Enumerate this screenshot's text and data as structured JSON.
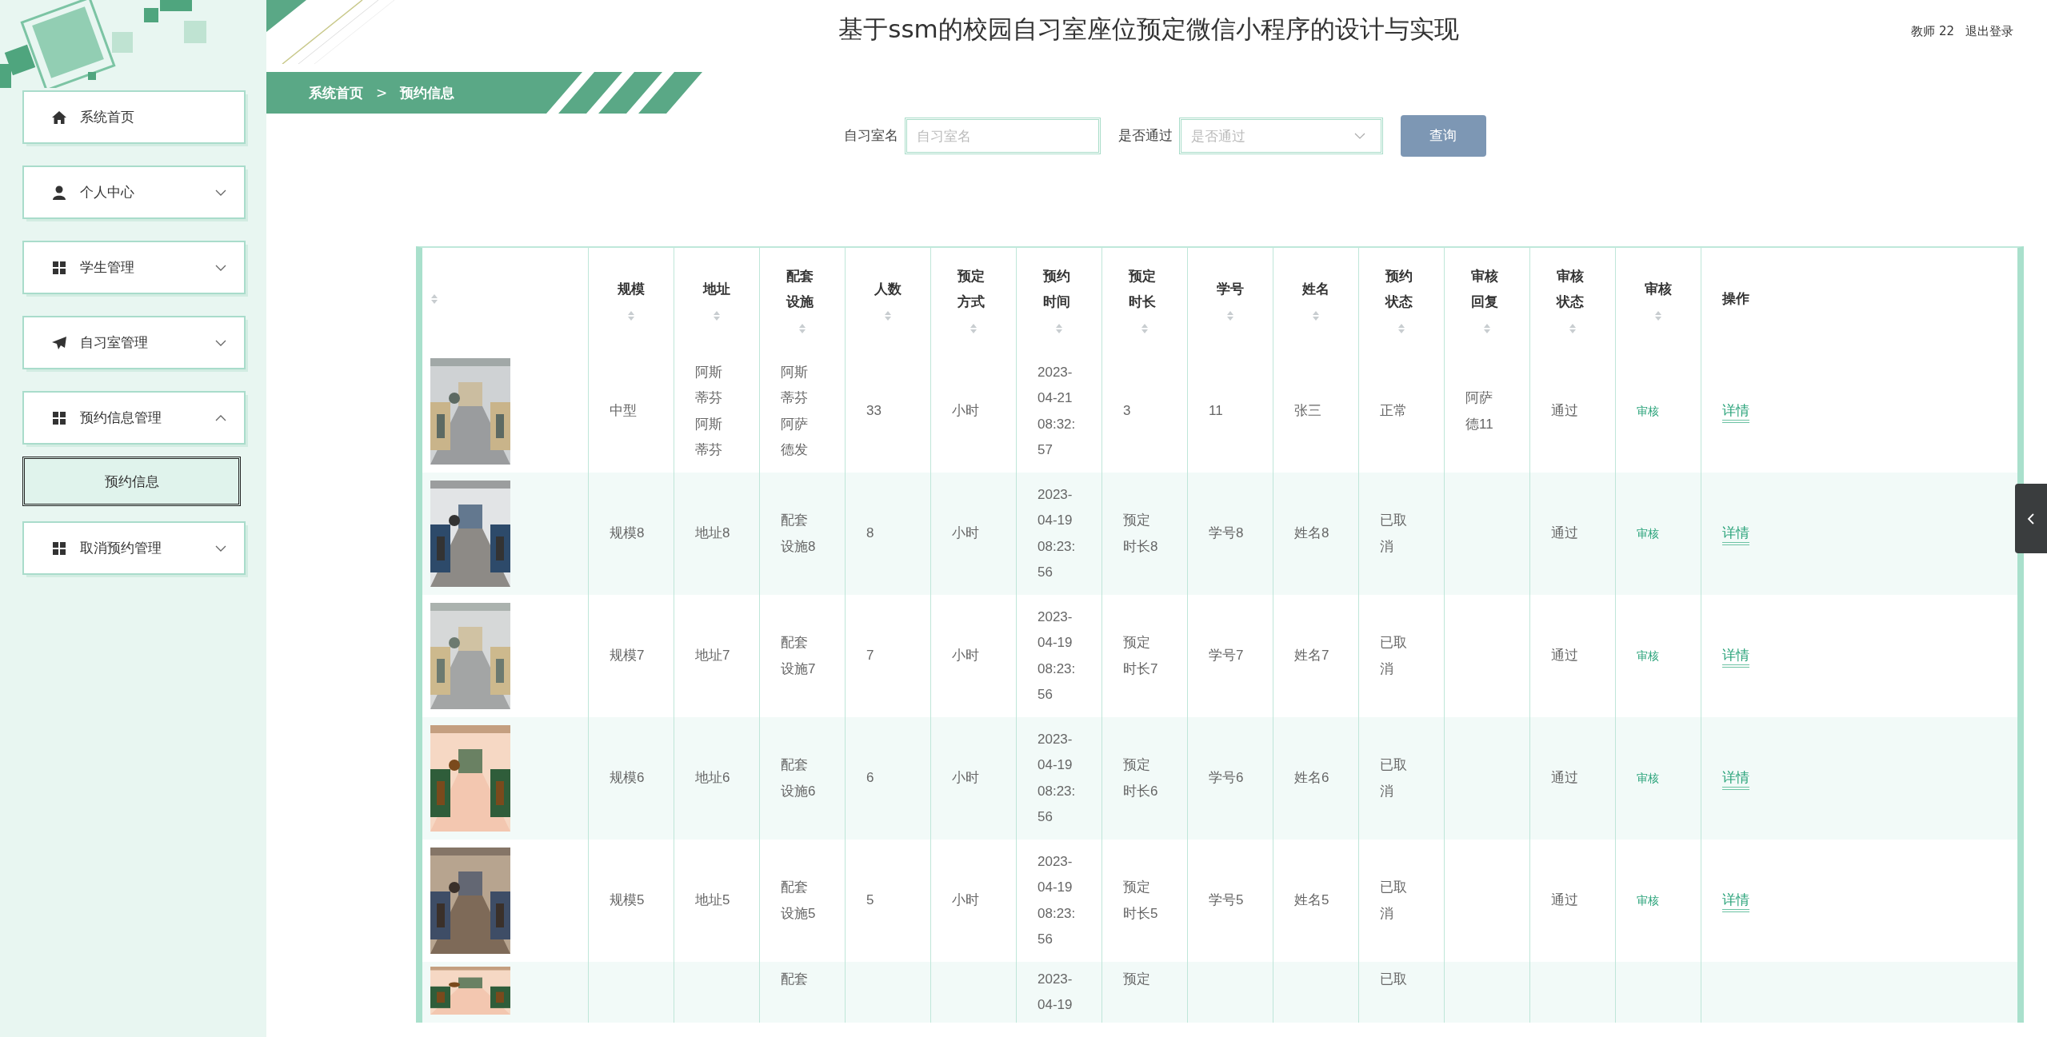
{
  "header": {
    "title": "基于ssm的校园自习室座位预定微信小程序的设计与实现",
    "user": "教师 22",
    "logout": "退出登录"
  },
  "breadcrumb": [
    "系统首页",
    ">",
    "预约信息"
  ],
  "sidebar": {
    "items": [
      {
        "label": "系统首页",
        "kind": "link"
      },
      {
        "label": "个人中心",
        "kind": "menu",
        "expanded": false
      },
      {
        "label": "学生管理",
        "kind": "menu",
        "expanded": false
      },
      {
        "label": "自习室管理",
        "kind": "menu",
        "expanded": false
      },
      {
        "label": "预约信息管理",
        "kind": "menu",
        "expanded": true,
        "children": [
          {
            "label": "预约信息",
            "selected": true
          }
        ]
      },
      {
        "label": "取消预约管理",
        "kind": "menu",
        "expanded": false
      }
    ]
  },
  "search": {
    "fields": [
      {
        "label": "自习室名",
        "placeholder": "自习室名",
        "kind": "text"
      },
      {
        "label": "是否通过",
        "placeholder": "是否通过",
        "kind": "select"
      }
    ],
    "button": "查询"
  },
  "table": {
    "image_column": {
      "sortable": true
    },
    "columns": [
      {
        "label": "规模",
        "sortable": true
      },
      {
        "label": "地址",
        "sortable": true
      },
      {
        "label": "配套设施",
        "sortable": true
      },
      {
        "label": "人数",
        "sortable": true
      },
      {
        "label": "预定方式",
        "sortable": true
      },
      {
        "label": "预约时间",
        "sortable": true
      },
      {
        "label": "预定时长",
        "sortable": true
      },
      {
        "label": "学号",
        "sortable": true
      },
      {
        "label": "姓名",
        "sortable": true
      },
      {
        "label": "预约状态",
        "sortable": true
      },
      {
        "label": "审核回复",
        "sortable": true
      },
      {
        "label": "审核状态",
        "sortable": true
      },
      {
        "label": "审核",
        "sortable": true
      },
      {
        "label": "操作",
        "sortable": false
      }
    ],
    "rows": [
      {
        "cells": [
          "中型",
          "阿斯蒂芬阿斯蒂芬",
          "阿斯蒂芬阿萨德发",
          "33",
          "小时",
          "2023-04-21 08:32:57",
          "3",
          "11",
          "张三",
          "正常",
          "阿萨德11",
          "通过"
        ],
        "review": "审核",
        "detail": "详情"
      },
      {
        "cells": [
          "规模8",
          "地址8",
          "配套设施8",
          "8",
          "小时",
          "2023-04-19 08:23:56",
          "预定时长8",
          "学号8",
          "姓名8",
          "已取消",
          "",
          "通过"
        ],
        "review": "审核",
        "detail": "详情"
      },
      {
        "cells": [
          "规模7",
          "地址7",
          "配套设施7",
          "7",
          "小时",
          "2023-04-19 08:23:56",
          "预定时长7",
          "学号7",
          "姓名7",
          "已取消",
          "",
          "通过"
        ],
        "review": "审核",
        "detail": "详情"
      },
      {
        "cells": [
          "规模6",
          "地址6",
          "配套设施6",
          "6",
          "小时",
          "2023-04-19 08:23:56",
          "预定时长6",
          "学号6",
          "姓名6",
          "已取消",
          "",
          "通过"
        ],
        "review": "审核",
        "detail": "详情"
      },
      {
        "cells": [
          "规模5",
          "地址5",
          "配套设施5",
          "5",
          "小时",
          "2023-04-19 08:23:56",
          "预定时长5",
          "学号5",
          "姓名5",
          "已取消",
          "",
          "通过"
        ],
        "review": "审核",
        "detail": "详情"
      },
      {
        "cells": [
          "",
          "",
          "配套",
          "",
          "",
          "2023-04-19",
          "预定",
          "",
          "",
          "已取",
          "",
          ""
        ]
      }
    ]
  }
}
